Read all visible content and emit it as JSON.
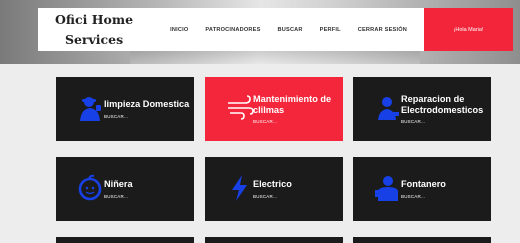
{
  "brand": {
    "line1": "Ofici Home",
    "line2": "Services"
  },
  "nav": {
    "items": [
      "INICIO",
      "PATROCINADORES",
      "BUSCAR",
      "PERFIL",
      "CERRAR SESIÓN"
    ],
    "cta": "¡Hola Maria!"
  },
  "colors": {
    "accent": "#f4263b",
    "card_dark": "#1b1b1b",
    "icon_blue": "#1740e6"
  },
  "services": [
    {
      "title": "limpieza Domestica",
      "action": "BUSCAR...",
      "icon": "cleaning-person-icon"
    },
    {
      "title": "Mantenimiento de clilmas",
      "action": "BUSCAR...",
      "icon": "air-conditioning-wind-icon"
    },
    {
      "title": "Reparacion de Electrodomesticos",
      "action": "BUSCAR...",
      "icon": "repair-technician-icon"
    },
    {
      "title": "Niñera",
      "action": "BUSCAR...",
      "icon": "baby-icon"
    },
    {
      "title": "Electrico",
      "action": "BUSCAR...",
      "icon": "lightning-bolt-icon"
    },
    {
      "title": "Fontanero",
      "action": "BUSCAR...",
      "icon": "plumber-icon"
    }
  ]
}
